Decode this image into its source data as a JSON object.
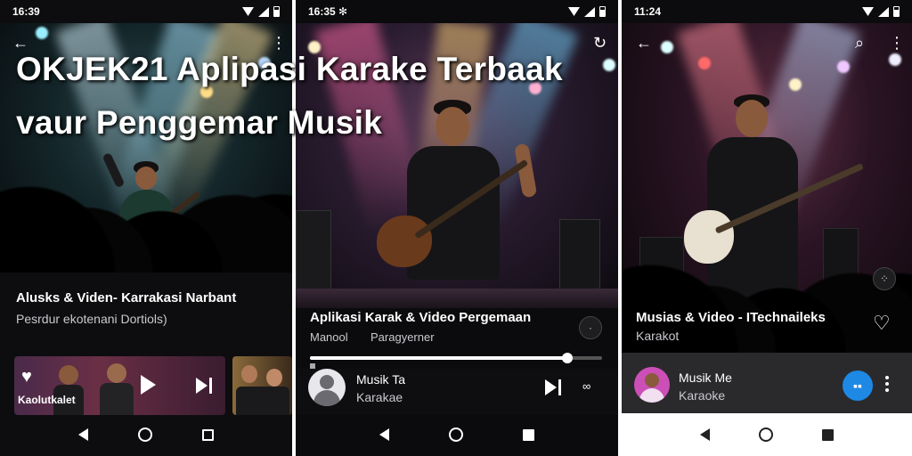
{
  "overlay": {
    "title_line1": "OKJEK21 Aplipasi Karake Terbaak",
    "title_line2": "vaur Penggemar Musik"
  },
  "screen1": {
    "status_time": "16:39",
    "song_title": "Alusks & Viden- Karrakasi Narbant",
    "song_subtitle": "Pesrdur ekotenani Dortiols)",
    "card_label": "Kaolutkalet"
  },
  "screen2": {
    "status_time": "16:35",
    "status_extra": "✻",
    "song_title": "Aplikasi Karak & Video Pergemaan",
    "meta_left": "Manool",
    "meta_right": "Paragyerner",
    "progress": 0.88,
    "mini_title": "Musik Ta",
    "mini_subtitle": "Karakae"
  },
  "screen3": {
    "status_time": "11:24",
    "song_title": "Musias & Video - ITechnaileks",
    "song_subtitle": "Karakot",
    "mini_title": "Musik Me",
    "mini_subtitle": "Karaoke"
  },
  "colors": {
    "accent_blue": "#1e88e5",
    "player_bar": "#2a2a2c"
  },
  "icons": [
    "back-arrow-icon",
    "more-vert-icon",
    "search-icon",
    "refresh-icon",
    "heart-icon",
    "play-icon",
    "skip-next-icon",
    "cast-icon"
  ]
}
